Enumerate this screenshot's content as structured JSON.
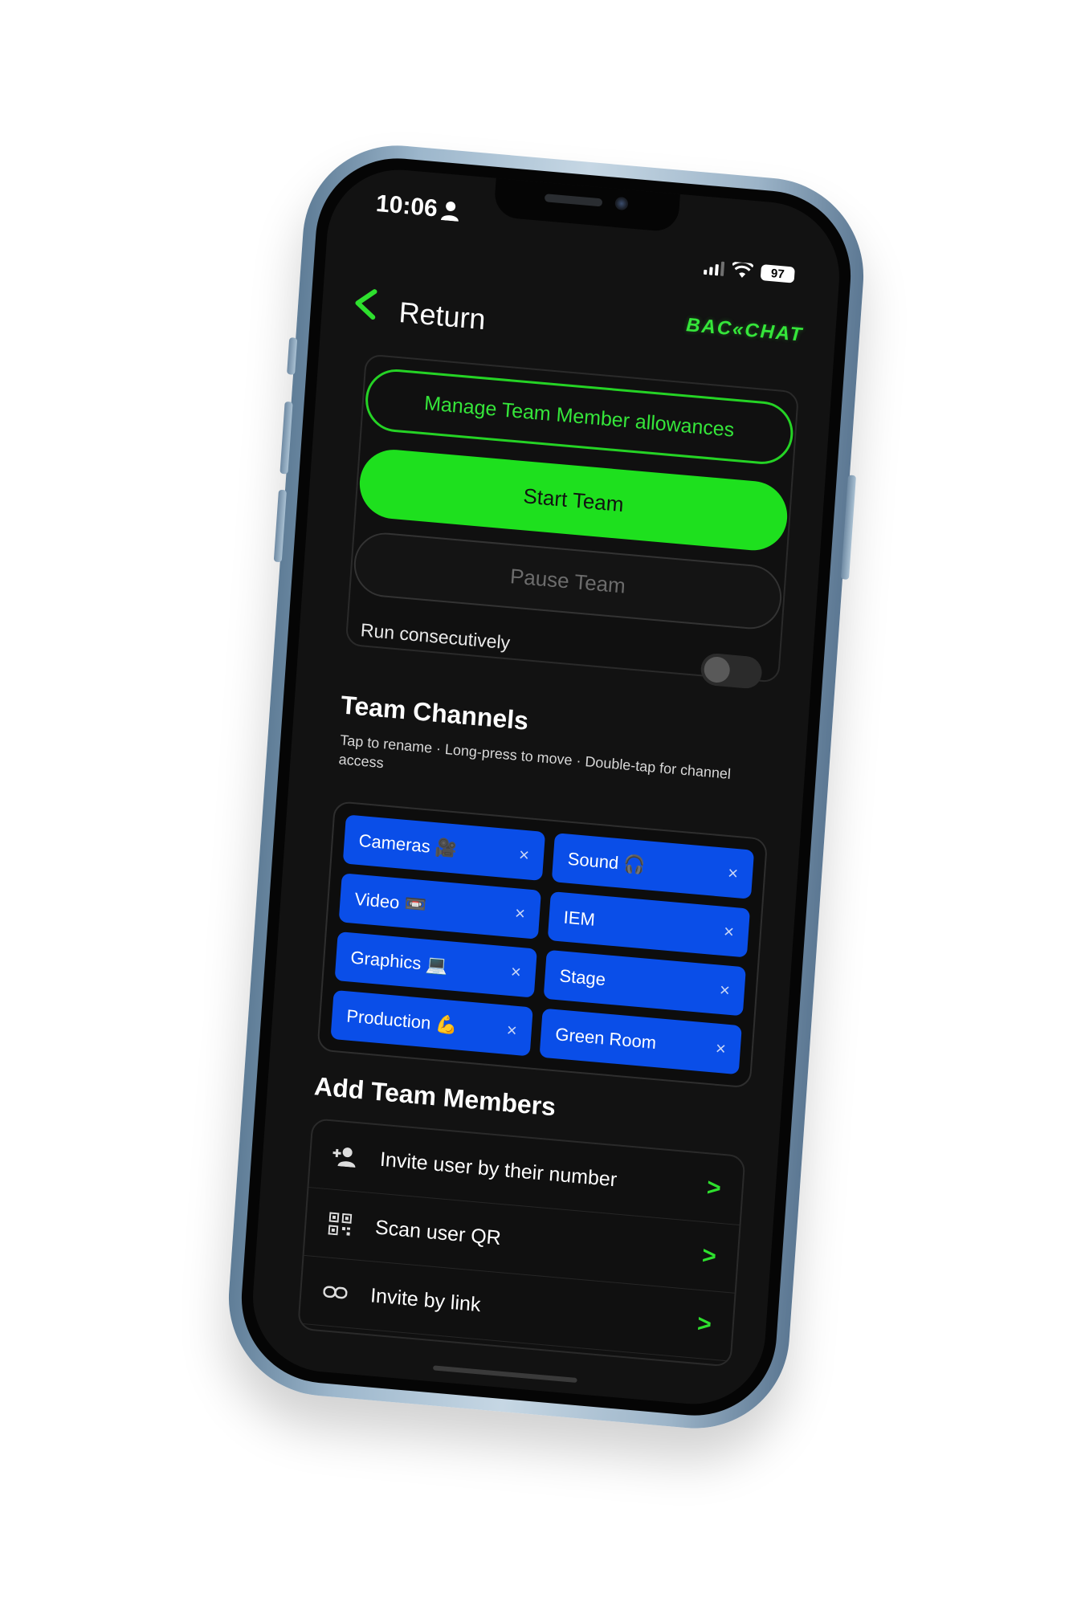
{
  "status_bar": {
    "time": "10:06",
    "battery": "97"
  },
  "header": {
    "back_label": "Return",
    "logo_text": "BAC«CHAT"
  },
  "controls": {
    "manage_label": "Manage Team Member allowances",
    "start_label": "Start Team",
    "pause_label": "Pause Team",
    "run_consecutively_label": "Run consecutively",
    "run_consecutively_on": false
  },
  "team_channels": {
    "title": "Team Channels",
    "hint": "Tap to rename · Long-press to move · Double-tap for channel access",
    "channels": [
      {
        "label": "Cameras 🎥"
      },
      {
        "label": "Sound 🎧"
      },
      {
        "label": "Video 📼"
      },
      {
        "label": "IEM"
      },
      {
        "label": "Graphics 💻"
      },
      {
        "label": "Stage"
      },
      {
        "label": "Production 💪"
      },
      {
        "label": "Green Room"
      }
    ],
    "close_glyph": "×"
  },
  "add_members": {
    "title": "Add Team Members",
    "items": [
      {
        "label": "Invite user by their number",
        "icon": "person-add-icon"
      },
      {
        "label": "Scan user QR",
        "icon": "qr-code-icon"
      },
      {
        "label": "Invite by link",
        "icon": "link-icon"
      }
    ],
    "chevron": ">"
  },
  "colors": {
    "accent_green": "#1ee01e",
    "chip_blue": "#0a4ee8",
    "background": "#121212"
  }
}
